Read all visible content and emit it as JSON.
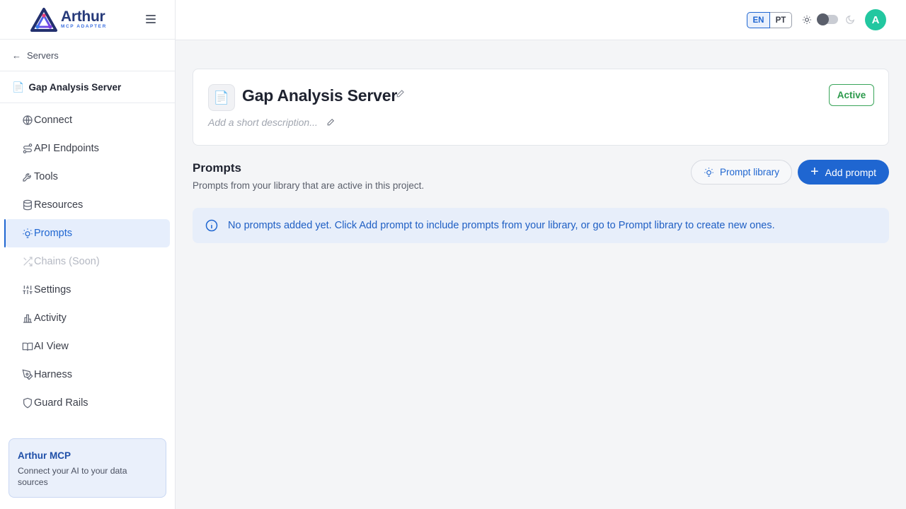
{
  "brand": {
    "name": "Arthur",
    "subtitle": "MCP ADAPTER"
  },
  "back": {
    "label": "Servers"
  },
  "server": {
    "name": "Gap Analysis Server"
  },
  "nav": {
    "items": [
      {
        "label": "Connect",
        "icon": "globe-icon"
      },
      {
        "label": "API Endpoints",
        "icon": "route-icon"
      },
      {
        "label": "Tools",
        "icon": "wrench-icon"
      },
      {
        "label": "Resources",
        "icon": "database-icon"
      },
      {
        "label": "Prompts",
        "icon": "lightbulb-icon",
        "active": true
      },
      {
        "label": "Chains (Soon)",
        "icon": "shuffle-icon",
        "disabled": true
      },
      {
        "label": "Settings",
        "icon": "sliders-icon"
      },
      {
        "label": "Activity",
        "icon": "bar-chart-icon"
      },
      {
        "label": "AI View",
        "icon": "book-icon"
      },
      {
        "label": "Harness",
        "icon": "pen-tool-icon"
      },
      {
        "label": "Guard Rails",
        "icon": "shield-icon"
      }
    ]
  },
  "promo": {
    "title": "Arthur MCP",
    "text": "Connect your AI to your data sources"
  },
  "topbar": {
    "lang_en": "EN",
    "lang_pt": "PT",
    "avatar_initial": "A"
  },
  "card": {
    "title": "Gap Analysis Server",
    "description_placeholder": "Add a short description...",
    "status": "Active"
  },
  "prompts": {
    "title": "Prompts",
    "subtitle": "Prompts from your library that are active in this project.",
    "library_button": "Prompt library",
    "add_button": "Add prompt",
    "empty_message": "No prompts added yet. Click Add prompt to include prompts from your library, or go to Prompt library to create new ones."
  },
  "colors": {
    "accent": "#1f66d1",
    "status_green": "#2c9a4c",
    "avatar": "#22c7a0",
    "brand_dark": "#263a7a"
  }
}
